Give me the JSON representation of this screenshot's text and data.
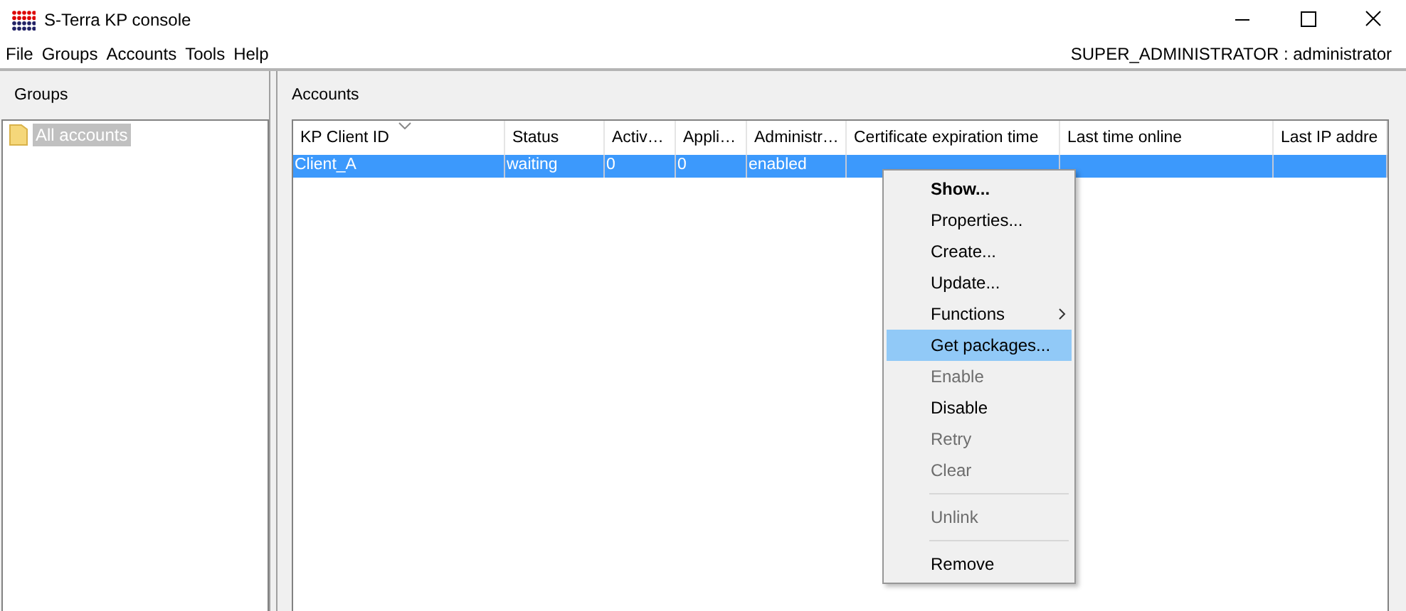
{
  "window": {
    "title": "S-Terra KP console"
  },
  "menu_bar": [
    {
      "label": "File"
    },
    {
      "label": "Groups"
    },
    {
      "label": "Accounts"
    },
    {
      "label": "Tools"
    },
    {
      "label": "Help"
    }
  ],
  "user_label": "SUPER_ADMINISTRATOR : administrator",
  "groups_panel": {
    "title": "Groups",
    "tree": [
      {
        "label": "All accounts",
        "selected": true
      }
    ]
  },
  "accounts_panel": {
    "title": "Accounts",
    "columns": [
      {
        "label": "KP Client ID",
        "sorted": true
      },
      {
        "label": "Status",
        "sorted": false
      },
      {
        "label": "Activ…",
        "sorted": false
      },
      {
        "label": "Appli…",
        "sorted": false
      },
      {
        "label": "Administr…",
        "sorted": false
      },
      {
        "label": "Certificate expiration time",
        "sorted": false
      },
      {
        "label": "Last time online",
        "sorted": false
      },
      {
        "label": "Last IP addre",
        "sorted": false
      }
    ],
    "rows": [
      {
        "cells": [
          "Client_A",
          "waiting",
          "0",
          "0",
          "enabled"
        ],
        "selected": true
      }
    ]
  },
  "context_menu": [
    {
      "kind": "item",
      "label": "Show...",
      "default": true,
      "disabled": false,
      "selected": false,
      "submenu": false
    },
    {
      "kind": "item",
      "label": "Properties...",
      "default": false,
      "disabled": false,
      "selected": false,
      "submenu": false
    },
    {
      "kind": "item",
      "label": "Create...",
      "default": false,
      "disabled": false,
      "selected": false,
      "submenu": false
    },
    {
      "kind": "item",
      "label": "Update...",
      "default": false,
      "disabled": false,
      "selected": false,
      "submenu": false
    },
    {
      "kind": "item",
      "label": "Functions",
      "default": false,
      "disabled": false,
      "selected": false,
      "submenu": true
    },
    {
      "kind": "item",
      "label": "Get packages...",
      "default": false,
      "disabled": false,
      "selected": true,
      "submenu": false
    },
    {
      "kind": "item",
      "label": "Enable",
      "default": false,
      "disabled": true,
      "selected": false,
      "submenu": false
    },
    {
      "kind": "item",
      "label": "Disable",
      "default": false,
      "disabled": false,
      "selected": false,
      "submenu": false
    },
    {
      "kind": "item",
      "label": "Retry",
      "default": false,
      "disabled": true,
      "selected": false,
      "submenu": false
    },
    {
      "kind": "item",
      "label": "Clear",
      "default": false,
      "disabled": true,
      "selected": false,
      "submenu": false
    },
    {
      "kind": "separator"
    },
    {
      "kind": "item",
      "label": "Unlink",
      "default": false,
      "disabled": true,
      "selected": false,
      "submenu": false
    },
    {
      "kind": "separator"
    },
    {
      "kind": "item",
      "label": "Remove",
      "default": false,
      "disabled": false,
      "selected": false,
      "submenu": false
    }
  ]
}
